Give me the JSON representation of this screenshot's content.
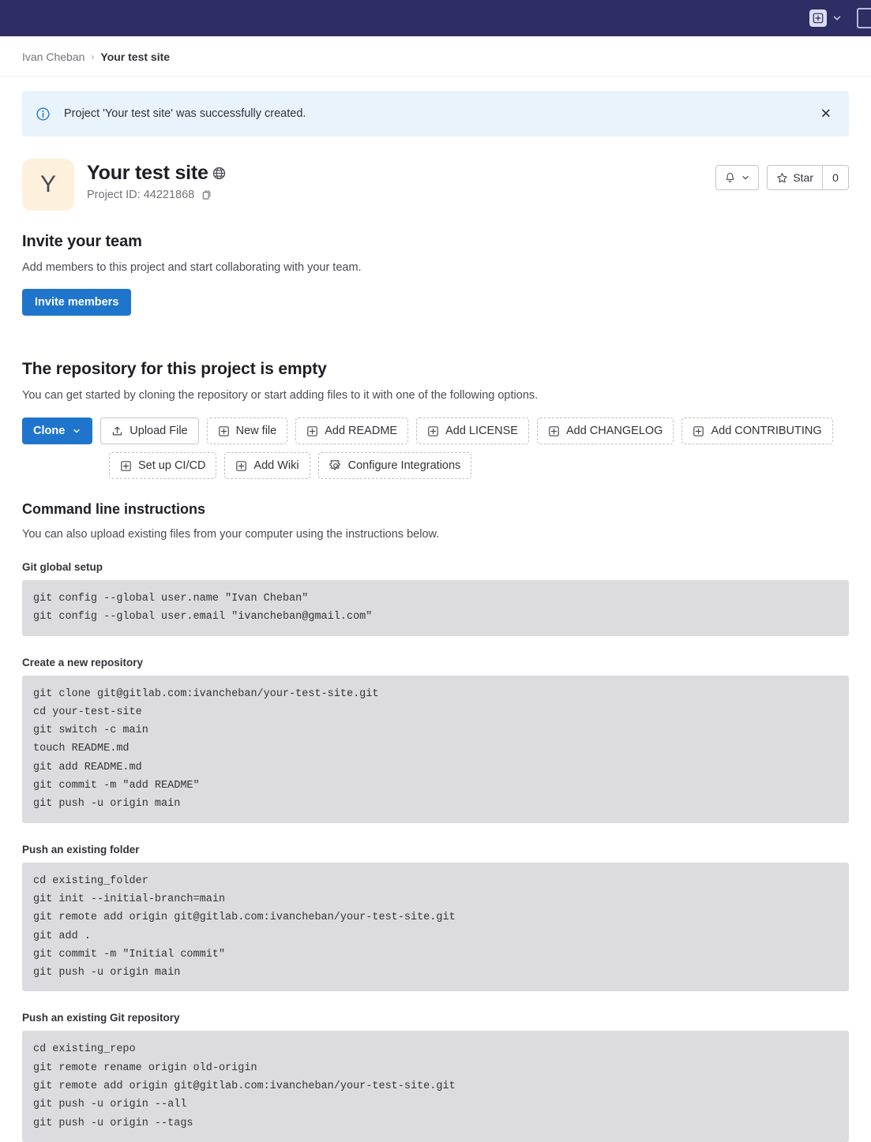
{
  "topbar": {
    "new_label": "+",
    "chevron": "⌄",
    "icons": [
      "plus-square-icon",
      "chevron-down-icon",
      "panel-icon"
    ]
  },
  "breadcrumb": {
    "owner": "Ivan Cheban",
    "separator": "›",
    "current": "Your test site"
  },
  "alert": {
    "message": "Project 'Your test site' was successfully created.",
    "close_label": "✕",
    "icon": "info-circle-icon",
    "bg_color": "#e9f3fc",
    "icon_color": "#1f75cb"
  },
  "project": {
    "avatar_letter": "Y",
    "avatar_bg": "#fdf1dd",
    "title": "Your test site",
    "visibility_icon": "globe-icon",
    "project_id_label": "Project ID: 44221868",
    "copy_icon": "clipboard-copy-icon",
    "notification_button": {
      "icon": "bell-icon",
      "chevron": "⌄"
    },
    "star_button": {
      "label": "Star",
      "icon": "star-icon",
      "count": "0"
    }
  },
  "invite": {
    "heading": "Invite your team",
    "description": "Add members to this project and start collaborating with your team.",
    "button_label": "Invite members",
    "button_color": "#1f75cb"
  },
  "empty_repo": {
    "heading": "The repository for this project is empty",
    "description": "You can get started by cloning the repository or start adding files to it with one of the following options."
  },
  "actions": {
    "row1": [
      {
        "label": "Clone",
        "style": "primary",
        "icon": "chevron-down-icon"
      },
      {
        "label": "Upload File",
        "style": "solid",
        "icon": "upload-icon"
      },
      {
        "label": "New file",
        "style": "dashed",
        "icon": "plus-square-icon"
      },
      {
        "label": "Add README",
        "style": "dashed",
        "icon": "plus-square-icon"
      },
      {
        "label": "Add LICENSE",
        "style": "dashed",
        "icon": "plus-square-icon"
      },
      {
        "label": "Add CHANGELOG",
        "style": "dashed",
        "icon": "plus-square-icon"
      },
      {
        "label": "Add CONTRIBUTING",
        "style": "dashed",
        "icon": "plus-square-icon"
      }
    ],
    "row2": [
      {
        "label": "Set up CI/CD",
        "style": "dashed",
        "icon": "plus-square-icon"
      },
      {
        "label": "Add Wiki",
        "style": "dashed",
        "icon": "plus-square-icon"
      },
      {
        "label": "Configure Integrations",
        "style": "dashed",
        "icon": "gear-icon"
      }
    ]
  },
  "cli": {
    "heading": "Command line instructions",
    "description": "You can also upload existing files from your computer using the instructions below.",
    "blocks": [
      {
        "label": "Git global setup",
        "code": "git config --global user.name \"Ivan Cheban\"\ngit config --global user.email \"ivancheban@gmail.com\""
      },
      {
        "label": "Create a new repository",
        "code": "git clone git@gitlab.com:ivancheban/your-test-site.git\ncd your-test-site\ngit switch -c main\ntouch README.md\ngit add README.md\ngit commit -m \"add README\"\ngit push -u origin main"
      },
      {
        "label": "Push an existing folder",
        "code": "cd existing_folder\ngit init --initial-branch=main\ngit remote add origin git@gitlab.com:ivancheban/your-test-site.git\ngit add .\ngit commit -m \"Initial commit\"\ngit push -u origin main"
      },
      {
        "label": "Push an existing Git repository",
        "code": "cd existing_repo\ngit remote rename origin old-origin\ngit remote add origin git@gitlab.com:ivancheban/your-test-site.git\ngit push -u origin --all\ngit push -u origin --tags"
      }
    ]
  }
}
